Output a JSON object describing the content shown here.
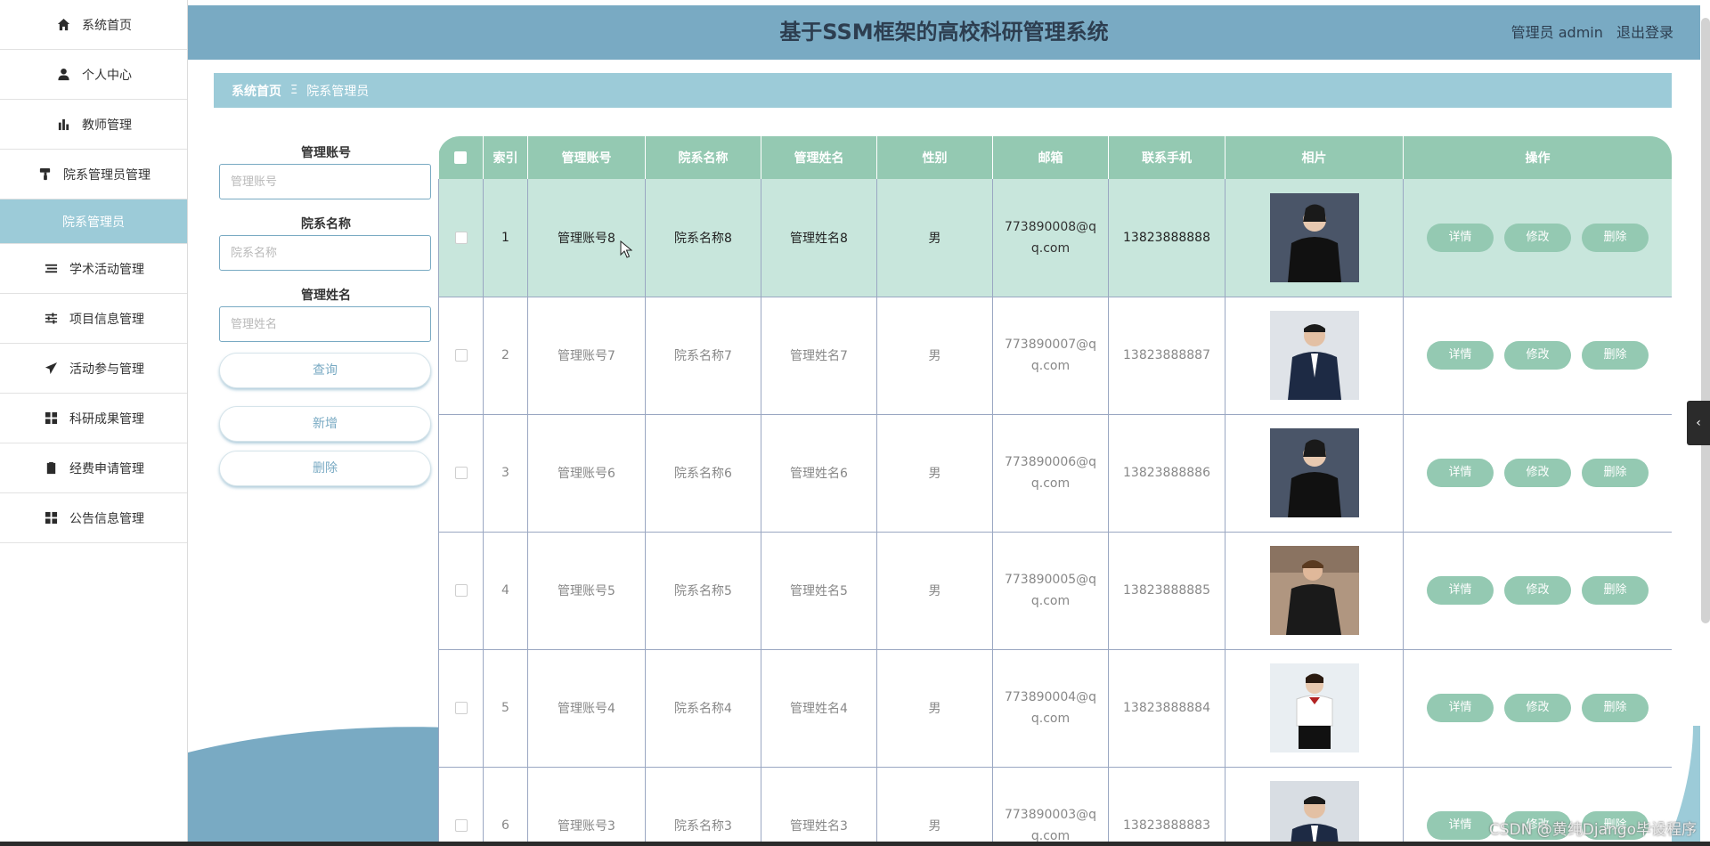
{
  "header": {
    "title": "基于SSM框架的高校科研管理系统",
    "user_label": "管理员 admin",
    "logout_label": "退出登录"
  },
  "sidebar": {
    "items": [
      {
        "label": "系统首页",
        "icon": "home-icon"
      },
      {
        "label": "个人中心",
        "icon": "user-icon"
      },
      {
        "label": "教师管理",
        "icon": "bar-chart-icon"
      },
      {
        "label": "院系管理员管理",
        "icon": "paint-roller-icon"
      },
      {
        "label": "院系管理员",
        "icon": ""
      },
      {
        "label": "学术活动管理",
        "icon": "list-icon"
      },
      {
        "label": "项目信息管理",
        "icon": "sliders-icon"
      },
      {
        "label": "活动参与管理",
        "icon": "send-icon"
      },
      {
        "label": "科研成果管理",
        "icon": "grid-icon"
      },
      {
        "label": "经费申请管理",
        "icon": "clipboard-check-icon"
      },
      {
        "label": "公告信息管理",
        "icon": "grid-icon"
      }
    ]
  },
  "breadcrumb": {
    "home": "系统首页",
    "separator": "Ξ",
    "current": "院系管理员"
  },
  "search": {
    "account_label": "管理账号",
    "account_placeholder": "管理账号",
    "dept_label": "院系名称",
    "dept_placeholder": "院系名称",
    "name_label": "管理姓名",
    "name_placeholder": "管理姓名",
    "query_button": "查询",
    "add_button": "新增",
    "delete_button": "删除"
  },
  "table": {
    "headers": [
      "索引",
      "管理账号",
      "院系名称",
      "管理姓名",
      "性别",
      "邮箱",
      "联系手机",
      "相片",
      "操作"
    ],
    "actions": {
      "detail": "详情",
      "edit": "修改",
      "delete": "删除"
    },
    "rows": [
      {
        "index": "1",
        "account": "管理账号8",
        "dept": "院系名称8",
        "name": "管理姓名8",
        "gender": "男",
        "email": "773890008@qq.com",
        "phone": "13823888888"
      },
      {
        "index": "2",
        "account": "管理账号7",
        "dept": "院系名称7",
        "name": "管理姓名7",
        "gender": "男",
        "email": "773890007@qq.com",
        "phone": "13823888887"
      },
      {
        "index": "3",
        "account": "管理账号6",
        "dept": "院系名称6",
        "name": "管理姓名6",
        "gender": "男",
        "email": "773890006@qq.com",
        "phone": "13823888886"
      },
      {
        "index": "4",
        "account": "管理账号5",
        "dept": "院系名称5",
        "name": "管理姓名5",
        "gender": "男",
        "email": "773890005@qq.com",
        "phone": "13823888885"
      },
      {
        "index": "5",
        "account": "管理账号4",
        "dept": "院系名称4",
        "name": "管理姓名4",
        "gender": "男",
        "email": "773890004@qq.com",
        "phone": "13823888884"
      },
      {
        "index": "6",
        "account": "管理账号3",
        "dept": "院系名称3",
        "name": "管理姓名3",
        "gender": "男",
        "email": "773890003@qq.com",
        "phone": "13823888883"
      }
    ]
  },
  "watermark": "CSDN @黄纯Django毕设程序",
  "colors": {
    "header": "#79aac3",
    "accent": "#9ccbd8",
    "table_header": "#94c9b2",
    "active_row": "#c8e6dc"
  }
}
